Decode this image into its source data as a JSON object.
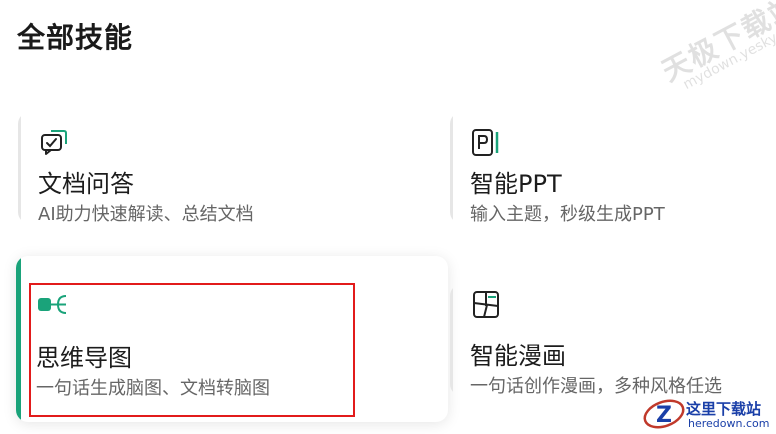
{
  "page": {
    "title": "全部技能"
  },
  "watermark": {
    "text_cn": "天极下载站",
    "text_url": "mydown.yesky.com"
  },
  "skills": [
    {
      "title": "文档问答",
      "desc": "AI助力快速解读、总结文档",
      "icon": "chat-document-icon"
    },
    {
      "title": "智能PPT",
      "desc": "输入主题，秒级生成PPT",
      "icon": "ppt-icon"
    },
    {
      "title": "思维导图",
      "desc": "一句话生成脑图、文档转脑图",
      "icon": "mindmap-icon"
    },
    {
      "title": "智能漫画",
      "desc": "一句话创作漫画，多种风格任选",
      "icon": "comic-icon"
    }
  ],
  "logo": {
    "text_cn": "这里下载站",
    "text_url": "heredown.com"
  },
  "colors": {
    "accent": "#1aa37a",
    "highlight": "#e21b1b",
    "logo": "#1a3fa8"
  }
}
